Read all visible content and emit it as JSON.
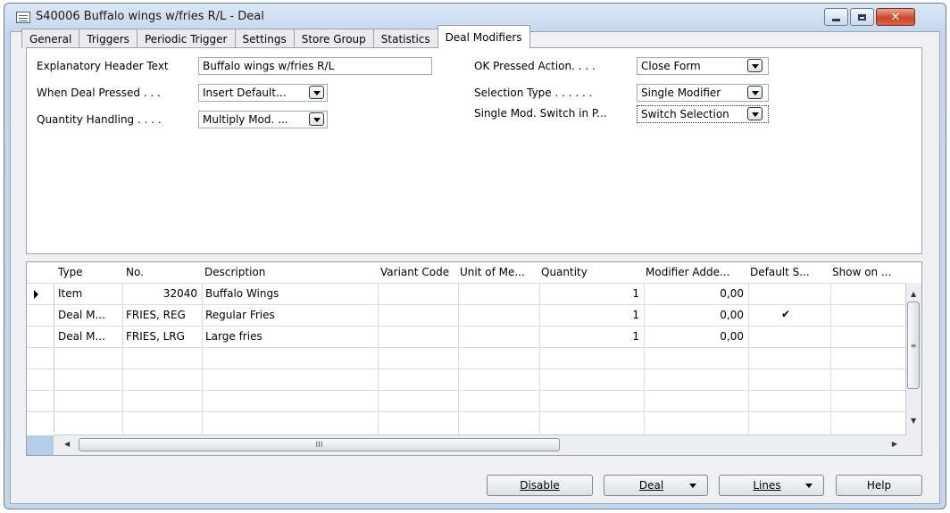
{
  "window": {
    "title": "S40006 Buffalo wings w/fries R/L - Deal"
  },
  "tabs": [
    {
      "label": "General"
    },
    {
      "label": "Triggers"
    },
    {
      "label": "Periodic Trigger"
    },
    {
      "label": "Settings"
    },
    {
      "label": "Store Group"
    },
    {
      "label": "Statistics"
    },
    {
      "label": "Deal Modifiers",
      "active": true
    }
  ],
  "form": {
    "explanatory_header_label": "Explanatory Header Text",
    "explanatory_header_value": "Buffalo wings w/fries R/L",
    "when_deal_pressed_label": "When Deal Pressed . . .",
    "when_deal_pressed_value": "Insert Default...",
    "quantity_handling_label": "Quantity Handling . . . .",
    "quantity_handling_value": "Multiply Mod. ...",
    "ok_pressed_label": "OK Pressed Action. . . .",
    "ok_pressed_value": "Close Form",
    "selection_type_label": "Selection Type . . . . . .",
    "selection_type_value": "Single Modifier",
    "single_mod_label": "Single Mod. Switch in P...",
    "single_mod_value": "Switch Selection"
  },
  "grid": {
    "columns": [
      "Type",
      "No.",
      "Description",
      "Variant Code",
      "Unit of Me...",
      "Quantity",
      "Modifier Adde...",
      "Default S...",
      "Show on ..."
    ],
    "rows": [
      {
        "type": "Item",
        "no": "32040",
        "description": "Buffalo Wings",
        "quantity": "1",
        "modifier_added": "0,00",
        "default_selected": false,
        "current": true
      },
      {
        "type": "Deal M...",
        "no": "FRIES, REG",
        "description": "Regular Fries",
        "quantity": "1",
        "modifier_added": "0,00",
        "default_selected": true,
        "current": false
      },
      {
        "type": "Deal M...",
        "no": "FRIES, LRG",
        "description": "Large fries",
        "quantity": "1",
        "modifier_added": "0,00",
        "default_selected": false,
        "current": false
      }
    ],
    "check_glyph": "✔"
  },
  "buttons": {
    "disable": "Disable",
    "deal": "Deal",
    "lines": "Lines",
    "help": "Help"
  }
}
